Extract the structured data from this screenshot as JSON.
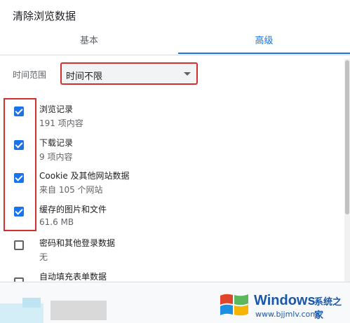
{
  "dialog": {
    "title": "清除浏览数据"
  },
  "tabs": [
    {
      "label": "基本",
      "active": false
    },
    {
      "label": "高级",
      "active": true
    }
  ],
  "time_range": {
    "label": "时间范围",
    "value": "时间不限"
  },
  "items": [
    {
      "label": "浏览记录",
      "sub": "191 项内容",
      "checked": true
    },
    {
      "label": "下载记录",
      "sub": "9 项内容",
      "checked": true
    },
    {
      "label": "Cookie 及其他网站数据",
      "sub": "来自 105 个网站",
      "checked": true
    },
    {
      "label": "缓存的图片和文件",
      "sub": "61.6 MB",
      "checked": true
    },
    {
      "label": "密码和其他登录数据",
      "sub": "无",
      "checked": false
    },
    {
      "label": "自动填充表单数据",
      "sub": "",
      "checked": false
    }
  ],
  "watermark": {
    "brand": "Windows",
    "brand_cn": "系统之家",
    "url": "www.bjjmlv.com"
  },
  "colors": {
    "accent": "#1a73e8",
    "highlight_border": "#d32f2f",
    "watermark": "#1a57a8"
  }
}
